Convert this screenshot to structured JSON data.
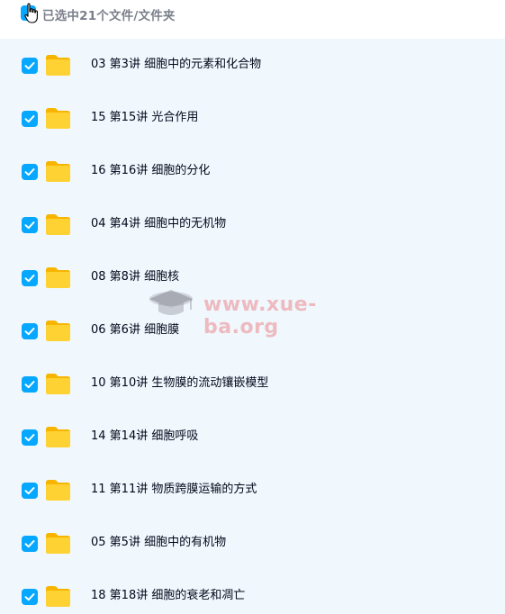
{
  "header": {
    "selection_label": "已选中21个文件/文件夹"
  },
  "items": [
    {
      "name": "03 第3讲 细胞中的元素和化合物",
      "checked": true,
      "icon": "folder-icon"
    },
    {
      "name": "15 第15讲 光合作用",
      "checked": true,
      "icon": "folder-icon"
    },
    {
      "name": "16 第16讲 细胞的分化",
      "checked": true,
      "icon": "folder-icon"
    },
    {
      "name": "04 第4讲 细胞中的无机物",
      "checked": true,
      "icon": "folder-icon"
    },
    {
      "name": "08 第8讲 细胞核",
      "checked": true,
      "icon": "folder-icon"
    },
    {
      "name": "06 第6讲 细胞膜",
      "checked": true,
      "icon": "folder-icon"
    },
    {
      "name": "10 第10讲 生物膜的流动镶嵌模型",
      "checked": true,
      "icon": "folder-icon"
    },
    {
      "name": "14 第14讲 细胞呼吸",
      "checked": true,
      "icon": "folder-icon"
    },
    {
      "name": "11 第11讲 物质跨膜运输的方式",
      "checked": true,
      "icon": "folder-icon"
    },
    {
      "name": "05 第5讲 细胞中的有机物",
      "checked": true,
      "icon": "folder-icon"
    },
    {
      "name": "18 第18讲 细胞的衰老和凋亡",
      "checked": true,
      "icon": "folder-icon"
    }
  ],
  "watermark": {
    "text": "www.xue-ba.org",
    "icon": "graduation-cap-icon"
  },
  "colors": {
    "accent": "#06a7ff",
    "list_background": "#f0f7fd",
    "folder": "#ffc71a",
    "text": "#03081a",
    "muted_text": "#7a7f8a"
  }
}
